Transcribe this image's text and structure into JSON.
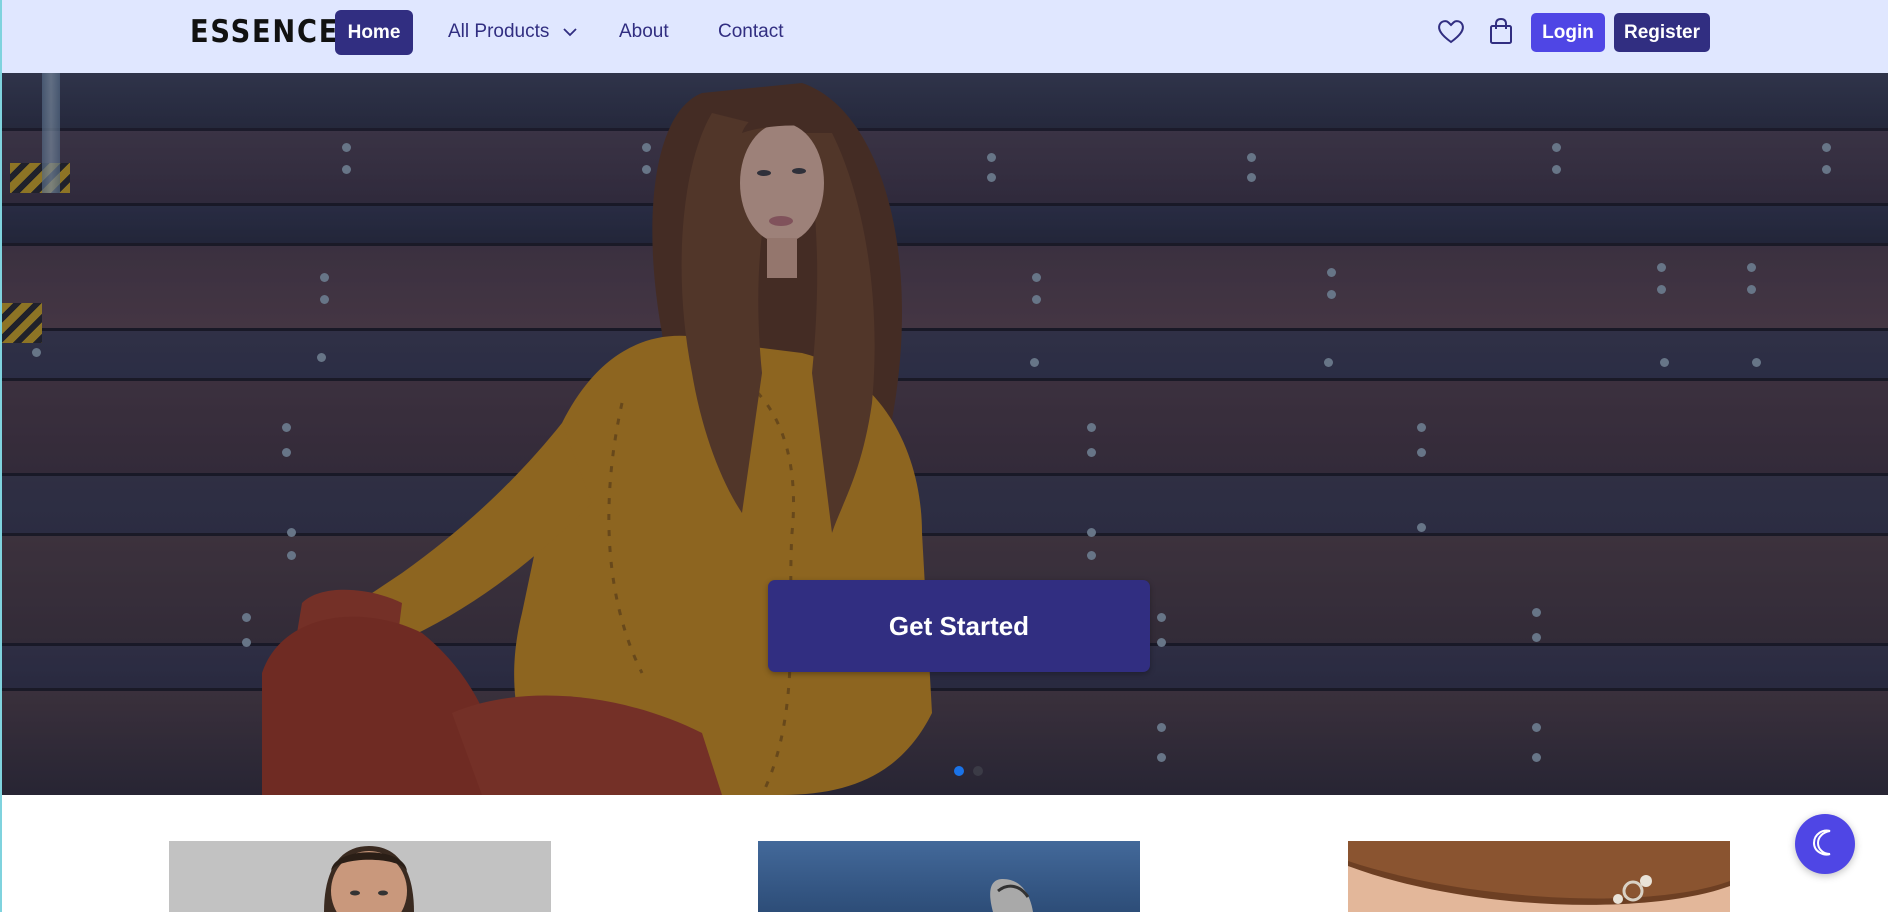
{
  "brand": {
    "name": "ESSENCE"
  },
  "nav": {
    "home": "Home",
    "products": "All Products",
    "about": "About",
    "contact": "Contact"
  },
  "icons": {
    "wishlist": "heart-icon",
    "cart": "shopping-bag-icon",
    "products_dropdown": "chevron-down-icon",
    "theme": "moon-icon"
  },
  "auth": {
    "login": "Login",
    "register": "Register"
  },
  "hero": {
    "cta": "Get Started",
    "carousel": {
      "slides": 2,
      "active": 1
    }
  },
  "colors": {
    "navbar_bg": "#e0e7ff",
    "primary_dark": "#312e81",
    "primary": "#4f46e5",
    "active_dot": "#1a73e8"
  },
  "products": [
    {
      "image": "man-portrait"
    },
    {
      "image": "sneaker-sky"
    },
    {
      "image": "bracelet-wrist"
    }
  ]
}
